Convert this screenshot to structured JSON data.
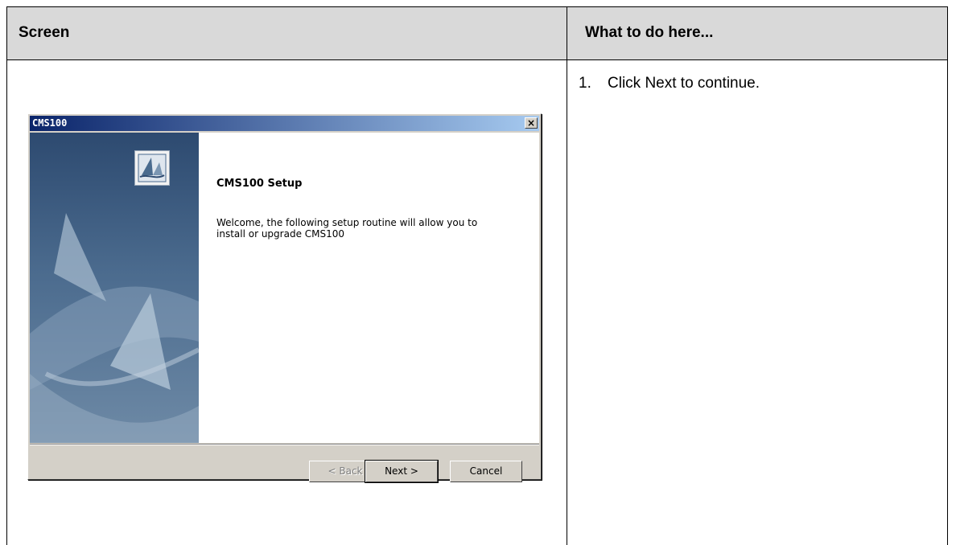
{
  "table": {
    "col1_header": "Screen",
    "col2_header": "What to do here..."
  },
  "instructions": [
    {
      "num": "1.",
      "text": "Click Next to continue."
    }
  ],
  "dialog": {
    "title": "CMS100",
    "close_label": "×",
    "setup_title": "CMS100 Setup",
    "welcome": "Welcome, the following setup routine will allow you to install or upgrade CMS100",
    "back_label": "< Back",
    "next_label": "Next >",
    "cancel_label": "Cancel"
  }
}
